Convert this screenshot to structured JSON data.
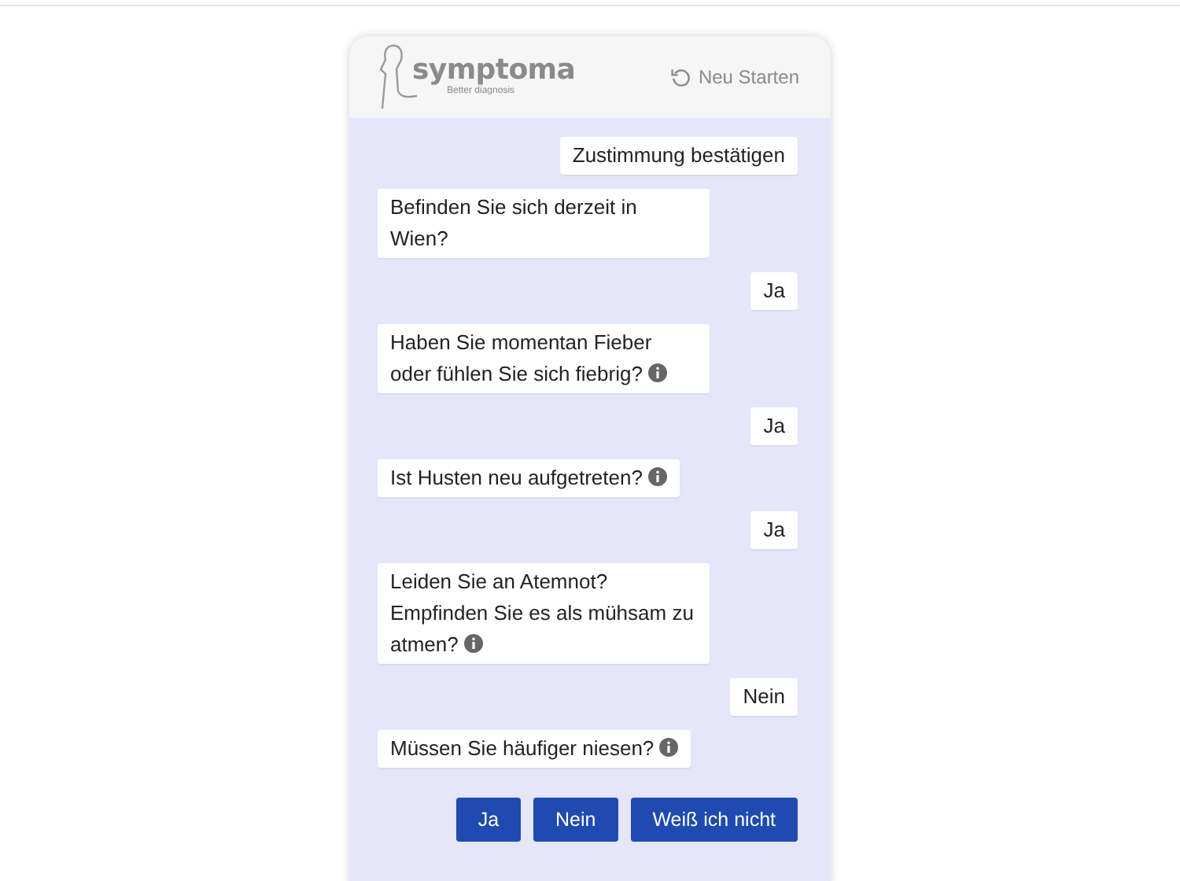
{
  "header": {
    "logo": "symptoma",
    "tagline": "Better diagnosis",
    "restart": "Neu Starten"
  },
  "messages": [
    {
      "kind": "user",
      "text": "Zustimmung bestätigen",
      "info": false
    },
    {
      "kind": "bot",
      "text": "Befinden Sie sich derzeit in Wien?",
      "info": false
    },
    {
      "kind": "user",
      "text": "Ja",
      "info": false
    },
    {
      "kind": "bot",
      "text": "Haben Sie momentan Fieber oder fühlen Sie sich fiebrig?",
      "info": true
    },
    {
      "kind": "user",
      "text": "Ja",
      "info": false
    },
    {
      "kind": "bot",
      "text": "Ist Husten neu aufgetreten?",
      "info": true
    },
    {
      "kind": "user",
      "text": "Ja",
      "info": false
    },
    {
      "kind": "bot",
      "text": "Leiden Sie an Atemnot? Empfinden Sie es als mühsam zu atmen?",
      "info": true
    },
    {
      "kind": "user",
      "text": "Nein",
      "info": false
    },
    {
      "kind": "bot",
      "text": "Müssen Sie häufiger niesen?",
      "info": true
    }
  ],
  "answers": [
    "Ja",
    "Nein",
    "Weiß ich nicht"
  ]
}
